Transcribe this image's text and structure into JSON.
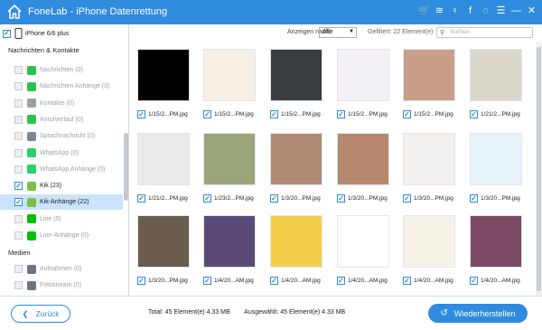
{
  "app": {
    "title": "FoneLab - iPhone Datenrettung",
    "accent": "#2f8bde"
  },
  "titlebar_icons": [
    "cart-icon",
    "wifi-icon",
    "key-icon",
    "facebook-icon",
    "chat-icon",
    "menu-icon",
    "minimize-icon",
    "close-icon"
  ],
  "titlebar_glyphs": [
    "🛒",
    "≋",
    "♀",
    "f",
    "◌",
    "☰",
    "—",
    "✕"
  ],
  "device": {
    "name": "iPhone 6/6 plus"
  },
  "sidebar": {
    "sections": [
      {
        "label": "Nachrichten & Kontakte"
      },
      {
        "label": "Medien"
      }
    ],
    "items": [
      {
        "label": "Nachrichten (0)",
        "color": "#2cc24b",
        "state": "disabled"
      },
      {
        "label": "Nachrichten Anhänge (0)",
        "color": "#2cc24b",
        "state": "disabled"
      },
      {
        "label": "Kontakte (0)",
        "color": "#9aa0a6",
        "state": "disabled"
      },
      {
        "label": "Anrufverlauf (0)",
        "color": "#2cc24b",
        "state": "disabled"
      },
      {
        "label": "Sprachnachricht (0)",
        "color": "#7c8590",
        "state": "disabled"
      },
      {
        "label": "WhatsApp (0)",
        "color": "#25d366",
        "state": "disabled"
      },
      {
        "label": "WhatsApp Anhänge (0)",
        "color": "#25d366",
        "state": "disabled"
      },
      {
        "label": "Kik (23)",
        "color": "#7ac143",
        "state": "checked"
      },
      {
        "label": "Kik-Anhänge (22)",
        "color": "#7ac143",
        "state": "active"
      },
      {
        "label": "Line (0)",
        "color": "#00c300",
        "state": "disabled"
      },
      {
        "label": "Line-Anhänge (0)",
        "color": "#00c300",
        "state": "disabled"
      },
      {
        "label": "Aufnahmen (0)",
        "color": "#6b7580",
        "state": "disabled"
      },
      {
        "label": "Fotostream (0)",
        "color": "#6b7580",
        "state": "disabled"
      }
    ]
  },
  "toolbar": {
    "show_label": "Anzeigen nach:",
    "show_value": "Alle",
    "filter_text": "Gefiltert: 22 Element(e)",
    "search_placeholder": "Suchen"
  },
  "files": [
    {
      "name": "1/15/2...PM.jpg",
      "bg": "#000000"
    },
    {
      "name": "1/15/2...PM.jpg",
      "bg": "#f5efe6"
    },
    {
      "name": "1/15/2...PM.jpg",
      "bg": "#3a3d40"
    },
    {
      "name": "1/15/2...PM.jpg",
      "bg": "#f3f1f5"
    },
    {
      "name": "1/15/2...PM.jpg",
      "bg": "#c8a08a"
    },
    {
      "name": "1/21/2...PM.jpg",
      "bg": "#dcd8cc"
    },
    {
      "name": "1/21/2...PM.jpg",
      "bg": "#eaeaea"
    },
    {
      "name": "1/23/2...PM.jpg",
      "bg": "#9aa57a"
    },
    {
      "name": "1/3/20...PM.jpg",
      "bg": "#b08a74"
    },
    {
      "name": "1/3/20...PM.jpg",
      "bg": "#b6896f"
    },
    {
      "name": "1/3/20...PM.jpg",
      "bg": "#f3f0f0"
    },
    {
      "name": "1/3/20...PM.jpg",
      "bg": "#e8f2f9"
    },
    {
      "name": "1/3/20...PM.jpg",
      "bg": "#6a5d4d"
    },
    {
      "name": "1/4/20...AM.jpg",
      "bg": "#5a4a78"
    },
    {
      "name": "1/4/20...AM.jpg",
      "bg": "#f5ce4c"
    },
    {
      "name": "1/4/20...AM.jpg",
      "bg": "#ffffff"
    },
    {
      "name": "1/4/20...AM.jpg",
      "bg": "#f6f2e8"
    },
    {
      "name": "1/4/20...AM.jpg",
      "bg": "#7a4b63"
    }
  ],
  "footer": {
    "back_label": "Zurück",
    "total": "Total: 45 Element(e) 4.33 MB",
    "selected": "Ausgewählt: 45 Element(e) 4.33 MB",
    "restore_label": "Wiederherstellen"
  }
}
